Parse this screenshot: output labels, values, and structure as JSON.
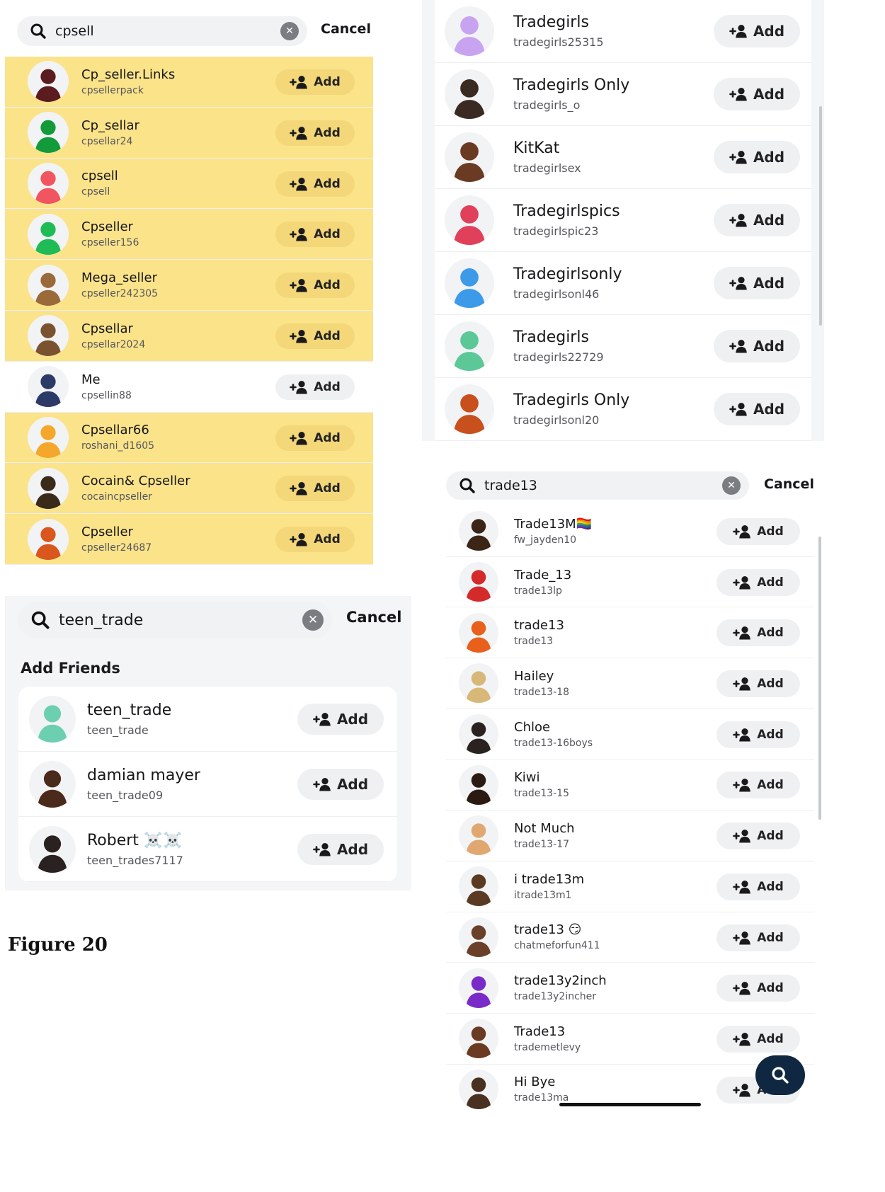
{
  "figure_label": "Figure 20",
  "colors": {
    "highlight": "#fbe38a",
    "add_bg": "#eff0f2",
    "search_bg": "#f1f2f4",
    "fab": "#0f2740"
  },
  "panel1": {
    "search": {
      "query": "cpsell",
      "cancel": "Cancel"
    },
    "add_label": "Add",
    "rows": [
      {
        "name": "Cp_seller.Links",
        "user": "cpsellerpack",
        "avatar_color": "#5a1c1f",
        "highlighted": true
      },
      {
        "name": "Cp_sellar",
        "user": "cpsellar24",
        "avatar_color": "#129a3b",
        "highlighted": true
      },
      {
        "name": "cpsell",
        "user": "cpsell",
        "avatar_color": "#f05560",
        "highlighted": true
      },
      {
        "name": "Cpseller",
        "user": "cpseller156",
        "avatar_color": "#1fbb55",
        "highlighted": true
      },
      {
        "name": "Mega_seller",
        "user": "cpseller242305",
        "avatar_color": "#9a6a3a",
        "highlighted": true
      },
      {
        "name": "Cpsellar",
        "user": "cpsellar2024",
        "avatar_color": "#7a5230",
        "highlighted": true
      },
      {
        "name": "Me",
        "user": "cpsellin88",
        "avatar_color": "#2b3a66",
        "highlighted": false
      },
      {
        "name": "Cpsellar66",
        "user": "roshani_d1605",
        "avatar_color": "#f4a72a",
        "highlighted": true
      },
      {
        "name": "Cocain& Cpseller",
        "user": "cocaincpseller",
        "avatar_color": "#3a2a1a",
        "highlighted": true
      },
      {
        "name": "Cpseller",
        "user": "cpseller24687",
        "avatar_color": "#d9561c",
        "highlighted": true
      }
    ]
  },
  "panel2": {
    "add_label": "Add",
    "rows": [
      {
        "name": "Tradegirls",
        "user": "tradegirls25315",
        "avatar_color": "#c8a4f0"
      },
      {
        "name": "Tradegirls Only",
        "user": "tradegirls_o",
        "avatar_color": "#3a2a22"
      },
      {
        "name": "KitKat",
        "user": "tradegirlsex",
        "avatar_color": "#6b3a22"
      },
      {
        "name": "Tradegirlspics",
        "user": "tradegirlspic23",
        "avatar_color": "#e0405a"
      },
      {
        "name": "Tradegirlsonly",
        "user": "tradegirlsonl46",
        "avatar_color": "#3c9ae8"
      },
      {
        "name": "Tradegirls",
        "user": "tradegirls22729",
        "avatar_color": "#5cc898"
      },
      {
        "name": "Tradegirls Only",
        "user": "tradegirlsonl20",
        "avatar_color": "#c8501c"
      }
    ]
  },
  "panel3": {
    "search": {
      "query": "teen_trade",
      "cancel": "Cancel"
    },
    "section_title": "Add Friends",
    "add_label": "Add",
    "rows": [
      {
        "name": "teen_trade",
        "user": "teen_trade",
        "avatar_color": "#6ccfb0"
      },
      {
        "name": "damian mayer",
        "user": "teen_trade09",
        "avatar_color": "#4a2a1a"
      },
      {
        "name": "Robert ☠️☠️",
        "user": "teen_trades7117",
        "avatar_color": "#2a2220"
      }
    ]
  },
  "panel4": {
    "search": {
      "query": "trade13",
      "cancel": "Cancel"
    },
    "add_label": "Add",
    "rows": [
      {
        "name": "Trade13M🏳️‍🌈",
        "user": "fw_jayden10",
        "avatar_color": "#3a2516"
      },
      {
        "name": "Trade_13",
        "user": "trade13lp",
        "avatar_color": "#d42a2a"
      },
      {
        "name": "trade13",
        "user": "trade13",
        "avatar_color": "#e8601c"
      },
      {
        "name": "Hailey",
        "user": "trade13-18",
        "avatar_color": "#d8b878"
      },
      {
        "name": "Chloe",
        "user": "trade13-16boys",
        "avatar_color": "#2a2220"
      },
      {
        "name": "Kiwi",
        "user": "trade13-15",
        "avatar_color": "#2a1a12"
      },
      {
        "name": "Not Much",
        "user": "trade13-17",
        "avatar_color": "#e0a870"
      },
      {
        "name": "i trade13m",
        "user": "itrade13m1",
        "avatar_color": "#5a3a22"
      },
      {
        "name": "trade13 😏",
        "user": "chatmeforfun411",
        "avatar_color": "#6a4028"
      },
      {
        "name": "trade13y2inch",
        "user": "trade13y2incher",
        "avatar_color": "#7a2ac8"
      },
      {
        "name": "Trade13",
        "user": "trademetlevy",
        "avatar_color": "#6a3a22"
      },
      {
        "name": "Hi Bye",
        "user": "trade13ma",
        "avatar_color": "#4a3020"
      }
    ]
  },
  "icons": {
    "search": "search-icon",
    "clear": "clear-icon",
    "add_friend": "add-friend-icon",
    "avatar": "avatar-icon"
  }
}
